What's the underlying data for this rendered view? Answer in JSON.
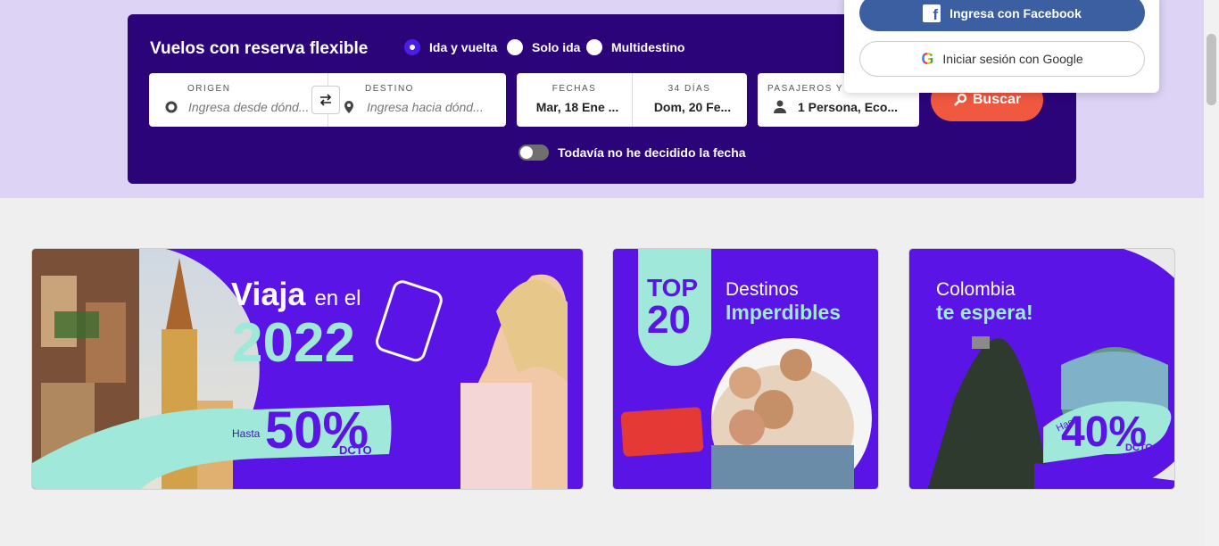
{
  "search": {
    "title": "Vuelos con reserva flexible",
    "trip_types": [
      {
        "label": "Ida y vuelta",
        "selected": true
      },
      {
        "label": "Solo ida",
        "selected": false
      },
      {
        "label": "Multidestino",
        "selected": false
      }
    ],
    "origin": {
      "label": "ORIGEN",
      "placeholder": "Ingresa desde dónd..."
    },
    "destination": {
      "label": "DESTINO",
      "placeholder": "Ingresa hacia dónd..."
    },
    "dates": {
      "label": "FECHAS",
      "value": "Mar, 18 Ene ..."
    },
    "days": {
      "label": "34 DÍAS",
      "value": "Dom, 20 Fe..."
    },
    "passengers": {
      "label": "PASAJEROS Y C",
      "value": "1 Persona, Eco..."
    },
    "search_button": "Buscar",
    "undecided_toggle": "Todavía no he decidido la fecha"
  },
  "login": {
    "facebook": "Ingresa con Facebook",
    "google": "Iniciar sesión con Google"
  },
  "banners": [
    {
      "line1": "Viaja",
      "line1b": "en el",
      "year": "2022",
      "hasta": "Hasta",
      "discount": "50%",
      "dcto": "DCTO"
    },
    {
      "top": "TOP",
      "num": "20",
      "line1": "Destinos",
      "line2": "Imperdibles"
    },
    {
      "line1": "Colombia",
      "line2": "te espera!",
      "hasta": "Hasta",
      "discount": "40%",
      "dcto": "DCTO"
    }
  ],
  "colors": {
    "panel": "#2b0479",
    "accent": "#5a14e6",
    "mint": "#9fe8da",
    "search_button": "#f0583f"
  }
}
